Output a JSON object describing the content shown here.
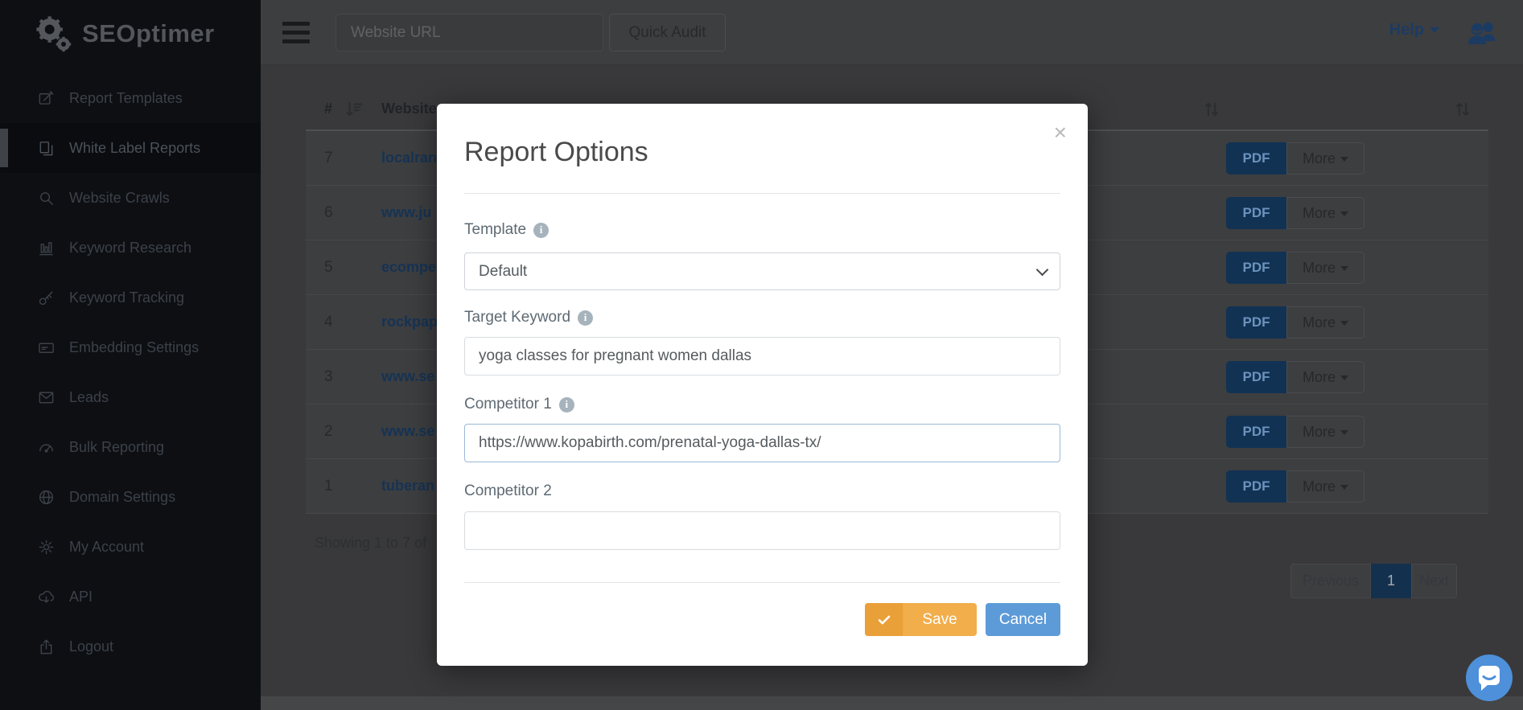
{
  "sidebar": {
    "logo_text": "SEOptimer",
    "items": [
      {
        "label": "Report Templates"
      },
      {
        "label": "White Label Reports",
        "active": true
      },
      {
        "label": "Website Crawls"
      },
      {
        "label": "Keyword Research"
      },
      {
        "label": "Keyword Tracking"
      },
      {
        "label": "Embedding Settings"
      },
      {
        "label": "Leads"
      },
      {
        "label": "Bulk Reporting"
      },
      {
        "label": "Domain Settings"
      },
      {
        "label": "My Account"
      },
      {
        "label": "API"
      },
      {
        "label": "Logout"
      }
    ]
  },
  "topbar": {
    "url_placeholder": "Website URL",
    "quick_audit_label": "Quick Audit",
    "help_label": "Help"
  },
  "table": {
    "col_num": "#",
    "col_website": "Website",
    "rows": [
      {
        "num": "7",
        "website": "localran"
      },
      {
        "num": "6",
        "website": "www.ju"
      },
      {
        "num": "5",
        "website": "ecompe"
      },
      {
        "num": "4",
        "website": "rockpap"
      },
      {
        "num": "3",
        "website": "www.se"
      },
      {
        "num": "2",
        "website": "www.se"
      },
      {
        "num": "1",
        "website": "tuberan"
      }
    ],
    "pdf_label": "PDF",
    "more_label": "More",
    "showing_text": "Showing 1 to 7 of",
    "pagination": {
      "prev": "Previous",
      "current": "1",
      "next": "Next"
    }
  },
  "modal": {
    "title": "Report Options",
    "template": {
      "label": "Template",
      "value": "Default"
    },
    "target_keyword": {
      "label": "Target Keyword",
      "value": "yoga classes for pregnant women dallas"
    },
    "competitor1": {
      "label": "Competitor 1",
      "value": "https://www.kopabirth.com/prenatal-yoga-dallas-tx/"
    },
    "competitor2": {
      "label": "Competitor 2",
      "value": ""
    },
    "save_label": "Save",
    "cancel_label": "Cancel"
  },
  "colors": {
    "save_yellow": "#f1ae4b",
    "save_yellow_dark": "#e9a038",
    "cancel_blue": "#5d9bd8",
    "chat_blue": "#4e90da",
    "help_navy": "#1c3b63",
    "pdf_navy_dimmed": "#113253",
    "link_navy_dimmed": "#163354",
    "pagination_active_dimmed": "#14304f",
    "sidebar_bg_dimmed": "#0d0f12",
    "backdrop_bg": "#3a3a3c",
    "modal_bg": "#ffffff"
  }
}
